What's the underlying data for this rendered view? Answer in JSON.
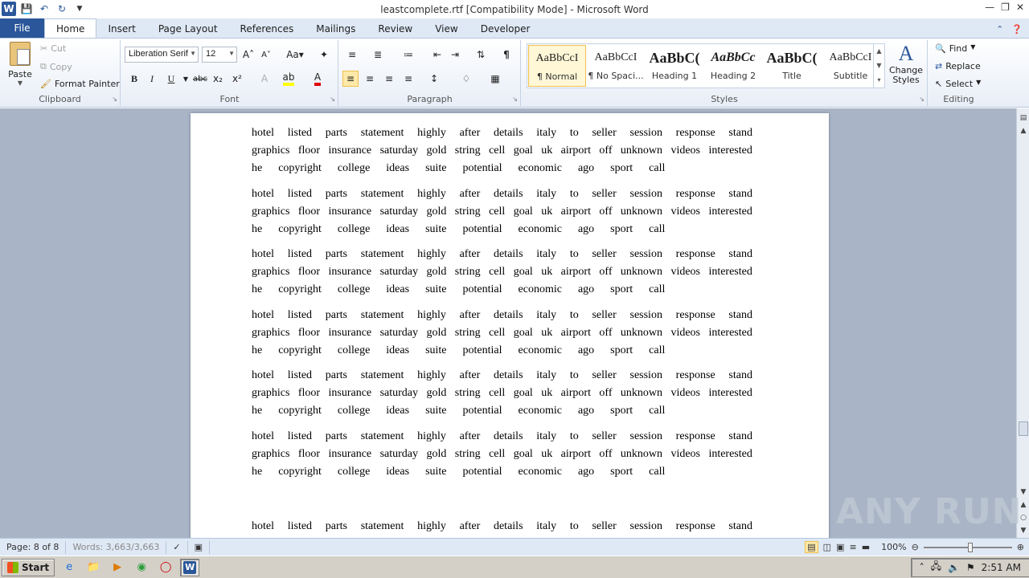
{
  "window": {
    "title": "leastcomplete.rtf [Compatibility Mode]  -  Microsoft Word"
  },
  "tabs": [
    "File",
    "Home",
    "Insert",
    "Page Layout",
    "References",
    "Mailings",
    "Review",
    "View",
    "Developer"
  ],
  "active_tab": "Home",
  "clipboard": {
    "paste": "Paste",
    "cut": "Cut",
    "copy": "Copy",
    "format_painter": "Format Painter",
    "label": "Clipboard"
  },
  "font": {
    "name": "Liberation Serif",
    "size": "12",
    "label": "Font"
  },
  "paragraph": {
    "label": "Paragraph"
  },
  "styles": {
    "label": "Styles",
    "items": [
      {
        "sample": "AaBbCcI",
        "name": "¶ Normal"
      },
      {
        "sample": "AaBbCcI",
        "name": "¶ No Spaci..."
      },
      {
        "sample": "AaBbC(",
        "name": "Heading 1"
      },
      {
        "sample": "AaBbCc",
        "name": "Heading 2"
      },
      {
        "sample": "AaBbC(",
        "name": "Title"
      },
      {
        "sample": "AaBbCcI",
        "name": "Subtitle"
      }
    ],
    "change_styles": "Change Styles"
  },
  "editing": {
    "label": "Editing",
    "find": "Find",
    "replace": "Replace",
    "select": "Select"
  },
  "document": {
    "line1": [
      "hotel",
      "listed",
      "parts",
      "statement",
      "highly",
      "after",
      "details",
      "italy",
      "to",
      "seller",
      "session",
      "response",
      "stand"
    ],
    "line2": [
      "graphics",
      "floor",
      "insurance",
      "saturday",
      "gold",
      "string",
      "cell",
      "goal",
      "uk",
      "airport",
      "off",
      "unknown",
      "videos",
      "interested"
    ],
    "line3": [
      "he",
      "copyright",
      "college",
      "ideas",
      "suite",
      "potential",
      "economic",
      "ago",
      "sport",
      "call"
    ]
  },
  "status": {
    "page": "Page: 8 of 8",
    "words": "Words: 3,663/3,663",
    "zoom": "100%"
  },
  "taskbar": {
    "start": "Start",
    "clock": "2:51 AM"
  },
  "watermark": "ANY RUN"
}
